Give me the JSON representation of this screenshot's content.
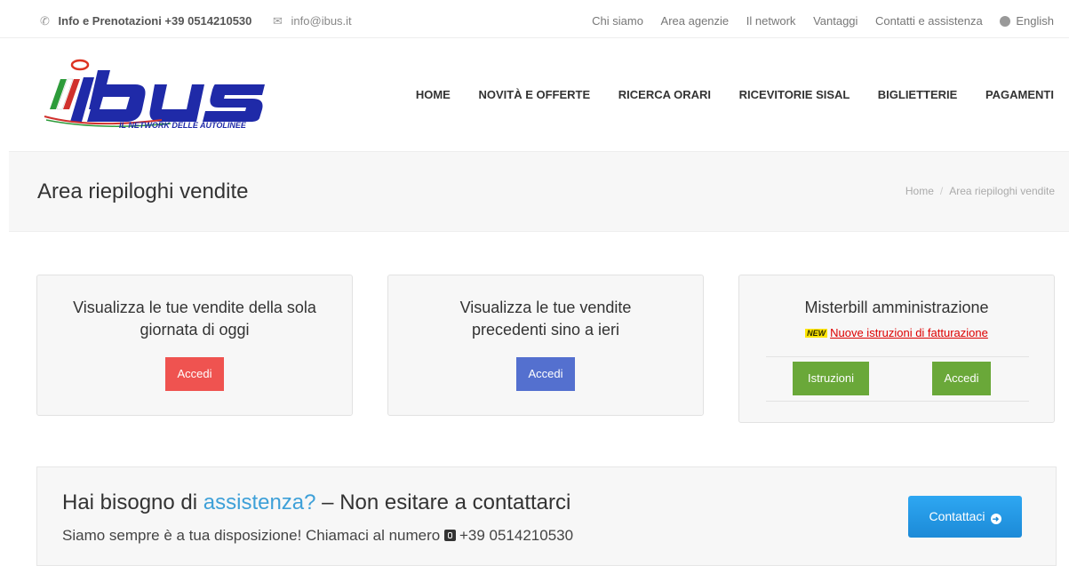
{
  "topbar": {
    "phone_label": "Info e Prenotazioni +39 0514210530",
    "email": "info@ibus.it",
    "links": [
      "Chi siamo",
      "Area agenzie",
      "Il network",
      "Vantaggi",
      "Contatti e assistenza"
    ],
    "language": "English"
  },
  "logo": {
    "brand": "ibus",
    "tagline": "IL NETWORK DELLE AUTOLINEE"
  },
  "nav": {
    "items": [
      "HOME",
      "NOVITÀ E OFFERTE",
      "RICERCA ORARI",
      "RICEVITORIE SISAL",
      "BIGLIETTERIE",
      "PAGAMENTI"
    ]
  },
  "page": {
    "title": "Area riepiloghi vendite",
    "breadcrumb": [
      "Home",
      "Area riepiloghi vendite"
    ]
  },
  "cards": [
    {
      "title": "Visualizza le tue vendite della sola giornata di oggi",
      "button": "Accedi"
    },
    {
      "title": "Visualizza le tue vendite precedenti sino a ieri",
      "button": "Accedi"
    },
    {
      "title": "Misterbill amministrazione",
      "new_badge": "NEW",
      "new_link": "Nuove istruzioni di fatturazione",
      "button_instructions": "Istruzioni",
      "button_access": "Accedi"
    }
  ],
  "assist": {
    "heading_pre": "Hai bisogno di ",
    "heading_highlight": "assistenza?",
    "heading_post": " – Non esitare a contattarci",
    "sub": "Siamo sempre è a tua disposizione! Chiamaci al numero",
    "phone": "+39 0514210530",
    "button": "Contattaci"
  },
  "colors": {
    "red_button": "#ef5350",
    "blue_button": "#5470cf",
    "green_button": "#6aa839",
    "contact_button": "#1c8ad7",
    "highlight": "#3ea0d8"
  }
}
